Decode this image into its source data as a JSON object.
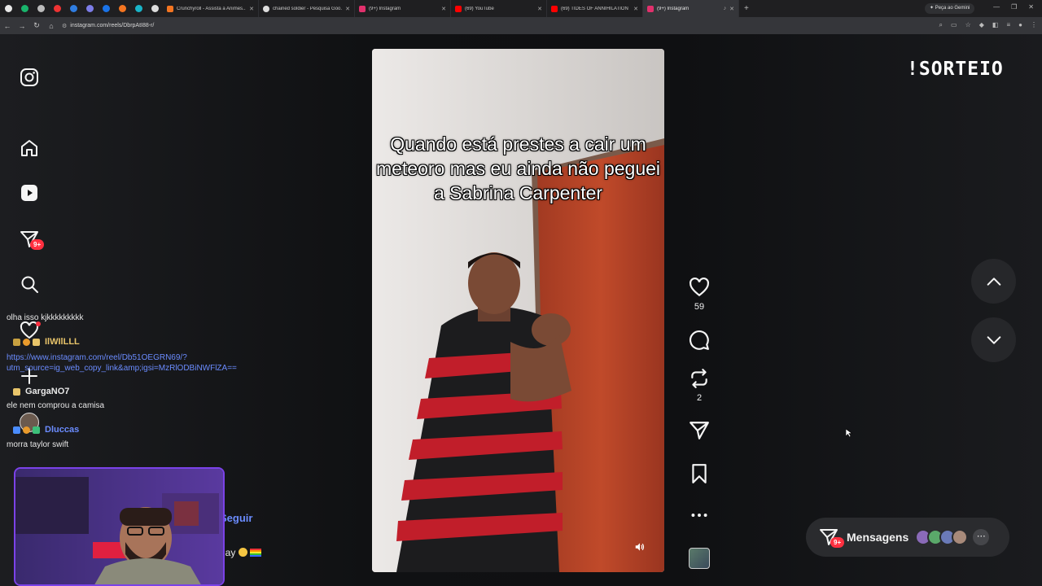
{
  "browser": {
    "tabs": [
      {
        "title": "Crunchyroll - Assista a Animes...",
        "icon_color": "#f47521",
        "active": false
      },
      {
        "title": "chained soldier - Pesquisa Goo...",
        "icon_color": "#dddddd",
        "active": false
      },
      {
        "title": "(9+) Instagram",
        "icon_color": "#e1306c",
        "active": false
      },
      {
        "title": "(69) YouTube",
        "icon_color": "#ff0000",
        "active": false
      },
      {
        "title": "(69) TIDES OF ANNIHILATION I...",
        "icon_color": "#ff0000",
        "active": false
      },
      {
        "title": "(9+) Instagram",
        "icon_color": "#e1306c",
        "active": true
      }
    ],
    "gemini_label": "Peça ao Gemini",
    "url": "instagram.com/reels/DbrpAtI88-r/"
  },
  "sidebar": {
    "notifications_badge": "9+"
  },
  "chat": {
    "messages": [
      {
        "text": "olha isso kjkkkkkkkkk"
      },
      {
        "user": "IlWIlLLL",
        "user_color": "#e8c46a"
      },
      {
        "text": "https://www.instagram.com/reel/Db51OEGRN69/?utm_source=ig_web_copy_link&amp;igsi=MzRlODBiNWFlZA==",
        "link": true
      },
      {
        "user": "GargaNO7",
        "user_color": "#e8e8e8"
      },
      {
        "text": "ele nem comprou a camisa"
      },
      {
        "user": "Dluccas",
        "user_color": "#6b8cff"
      },
      {
        "text": "morra taylor swift"
      }
    ],
    "follow_label": "Seguir",
    "overlap_text": "gay"
  },
  "reel": {
    "caption": "Quando está prestes a cair um meteoro mas eu ainda não peguei a Sabrina Carpenter",
    "likes": "59",
    "reposts": "2"
  },
  "overlay": {
    "sorteio": "!SORTEIO"
  },
  "messages_bar": {
    "label": "Mensagens",
    "badge": "9+"
  },
  "colors": {
    "accent_badge": "#ff3040",
    "link": "#6b8cff"
  }
}
